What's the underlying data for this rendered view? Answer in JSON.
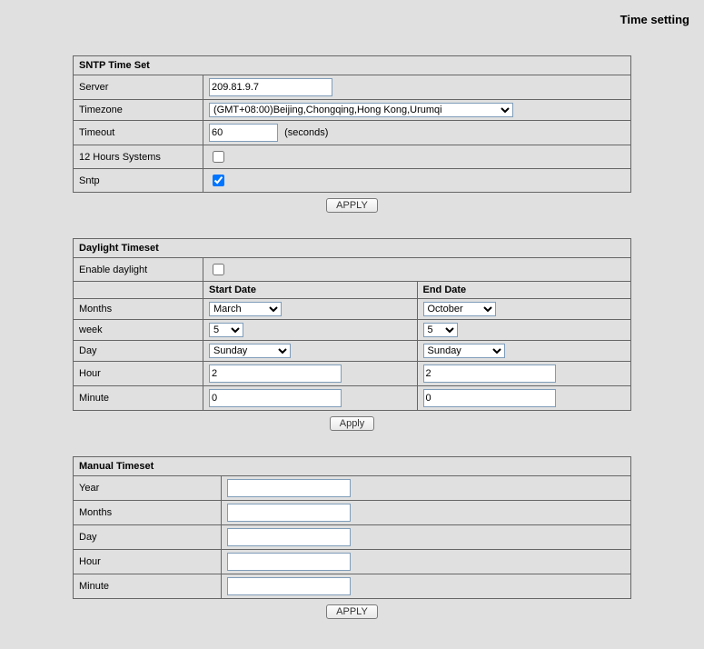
{
  "page_title": "Time setting",
  "sntp": {
    "section_title": "SNTP Time Set",
    "rows": {
      "server": {
        "label": "Server",
        "value": "209.81.9.7"
      },
      "timezone": {
        "label": "Timezone",
        "value": "(GMT+08:00)Beijing,Chongqing,Hong Kong,Urumqi"
      },
      "timeout": {
        "label": "Timeout",
        "value": "60",
        "suffix": "(seconds)"
      },
      "hours12": {
        "label": "12 Hours Systems",
        "checked": false
      },
      "sntp": {
        "label": "Sntp",
        "checked": true
      }
    },
    "apply_label": "APPLY"
  },
  "daylight": {
    "section_title": "Daylight Timeset",
    "enable": {
      "label": "Enable daylight",
      "checked": false
    },
    "start_header": "Start Date",
    "end_header": "End Date",
    "rows": {
      "months": {
        "label": "Months",
        "start": "March",
        "end": "October"
      },
      "week": {
        "label": "week",
        "start": "5",
        "end": "5"
      },
      "day": {
        "label": "Day",
        "start": "Sunday",
        "end": "Sunday"
      },
      "hour": {
        "label": "Hour",
        "start": "2",
        "end": "2"
      },
      "minute": {
        "label": "Minute",
        "start": "0",
        "end": "0"
      }
    },
    "apply_label": "Apply"
  },
  "manual": {
    "section_title": "Manual Timeset",
    "rows": {
      "year": {
        "label": "Year",
        "value": ""
      },
      "months": {
        "label": "Months",
        "value": ""
      },
      "day": {
        "label": "Day",
        "value": ""
      },
      "hour": {
        "label": "Hour",
        "value": ""
      },
      "minute": {
        "label": "Minute",
        "value": ""
      }
    },
    "apply_label": "APPLY"
  }
}
